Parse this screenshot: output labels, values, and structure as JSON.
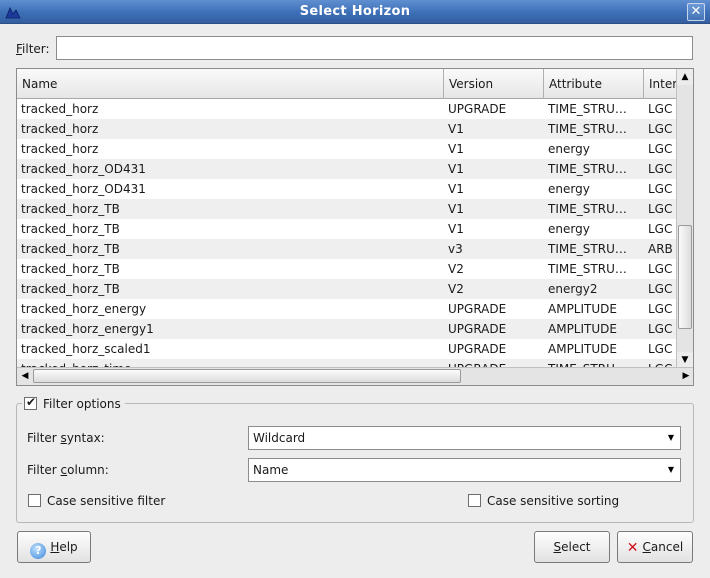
{
  "window": {
    "title": "Select Horizon",
    "close_glyph": "✕"
  },
  "filter": {
    "label_pre": "",
    "label_underline": "F",
    "label_post": "ilter:",
    "value": ""
  },
  "table": {
    "columns": [
      "Name",
      "Version",
      "Attribute",
      "Inter"
    ],
    "rows": [
      [
        "tracked_horz",
        "UPGRADE",
        "TIME_STRU…",
        "LGC"
      ],
      [
        "tracked_horz",
        "V1",
        "TIME_STRU…",
        "LGC"
      ],
      [
        "tracked_horz",
        "V1",
        "energy",
        "LGC"
      ],
      [
        "tracked_horz_OD431",
        "V1",
        "TIME_STRU…",
        "LGC"
      ],
      [
        "tracked_horz_OD431",
        "V1",
        "energy",
        "LGC"
      ],
      [
        "tracked_horz_TB",
        "V1",
        "TIME_STRU…",
        "LGC"
      ],
      [
        "tracked_horz_TB",
        "V1",
        "energy",
        "LGC"
      ],
      [
        "tracked_horz_TB",
        "v3",
        "TIME_STRU…",
        "ARB"
      ],
      [
        "tracked_horz_TB",
        "V2",
        "TIME_STRU…",
        "LGC"
      ],
      [
        "tracked_horz_TB",
        "V2",
        "energy2",
        "LGC"
      ],
      [
        "tracked_horz_energy",
        "UPGRADE",
        "AMPLITUDE",
        "LGC"
      ],
      [
        "tracked_horz_energy1",
        "UPGRADE",
        "AMPLITUDE",
        "LGC"
      ],
      [
        "tracked_horz_scaled1",
        "UPGRADE",
        "AMPLITUDE",
        "LGC"
      ],
      [
        "tracked_horz_time",
        "UPGRADE",
        "TIME_STRU…",
        "LGC"
      ]
    ]
  },
  "filter_options": {
    "legend": "Filter options",
    "checked": true,
    "syntax_label_pre": "Filter ",
    "syntax_label_u": "s",
    "syntax_label_post": "yntax:",
    "syntax_value": "Wildcard",
    "column_label_pre": "Filter ",
    "column_label_u": "c",
    "column_label_post": "olumn:",
    "column_value": "Name",
    "case_filter_label": "Case sensitive filter",
    "case_sort_label": "Case sensitive sorting"
  },
  "buttons": {
    "help_u": "H",
    "help_rest": "elp",
    "select_u": "S",
    "select_rest": "elect",
    "cancel_u": "C",
    "cancel_rest": "ancel"
  }
}
